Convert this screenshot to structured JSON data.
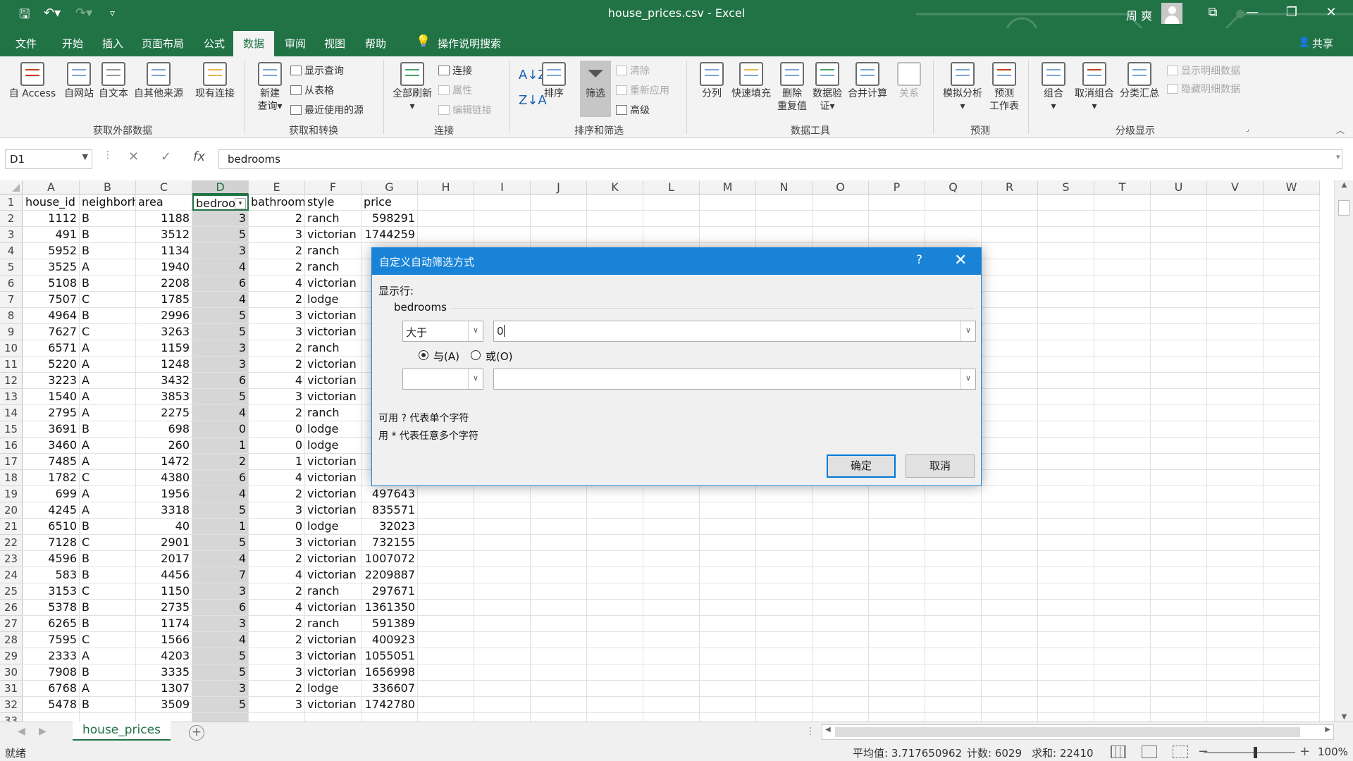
{
  "window": {
    "title": "house_prices.csv  -  Excel",
    "user": "周 爽"
  },
  "menu": {
    "tabs": [
      "文件",
      "开始",
      "插入",
      "页面布局",
      "公式",
      "数据",
      "审阅",
      "视图",
      "帮助"
    ],
    "active": "数据",
    "search": "操作说明搜索",
    "share": "共享"
  },
  "ribbon": {
    "ext": {
      "access": "自 Access",
      "web": "自网站",
      "text": "自文本",
      "other": "自其他来源",
      "existing": "现有连接",
      "label": "获取外部数据"
    },
    "gt": {
      "newq1": "新建",
      "newq2": "查询",
      "show": "显示查询",
      "table": "从表格",
      "recent": "最近使用的源",
      "label": "获取和转换"
    },
    "conn": {
      "refresh": "全部刷新",
      "connections": "连接",
      "properties": "属性",
      "editlinks": "编辑链接",
      "label": "连接"
    },
    "sort": {
      "sort": "排序",
      "filter": "筛选",
      "clear": "清除",
      "reapply": "重新应用",
      "advanced": "高级",
      "label": "排序和筛选"
    },
    "tools": {
      "t2c": "分列",
      "flash": "快速填充",
      "dup1": "删除",
      "dup2": "重复值",
      "val1": "数据验",
      "val2": "证",
      "consolidate": "合并计算",
      "relations": "关系",
      "label": "数据工具"
    },
    "forecast": {
      "whatif": "模拟分析",
      "sheet1": "预测",
      "sheet2": "工作表",
      "label": "预测"
    },
    "outline": {
      "group": "组合",
      "ungroup": "取消组合",
      "subtotal": "分类汇总",
      "showdetail": "显示明细数据",
      "hidedetail": "隐藏明细数据",
      "label": "分级显示"
    }
  },
  "formula": {
    "namebox": "D1",
    "fx": "fx",
    "content": "bedrooms"
  },
  "grid": {
    "columns": [
      "A",
      "B",
      "C",
      "D",
      "E",
      "F",
      "G",
      "H",
      "I",
      "J",
      "K",
      "L",
      "M",
      "N",
      "O",
      "P",
      "Q",
      "R",
      "S",
      "T",
      "U",
      "V",
      "W"
    ],
    "headers": [
      "house_id",
      "neighborh",
      "area",
      "bedroo",
      "bathroom",
      "style",
      "price"
    ],
    "rows": [
      [
        "1112",
        "B",
        "1188",
        "3",
        "2",
        "ranch",
        "598291"
      ],
      [
        "491",
        "B",
        "3512",
        "5",
        "3",
        "victorian",
        "1744259"
      ],
      [
        "5952",
        "B",
        "1134",
        "3",
        "2",
        "ranch",
        ""
      ],
      [
        "3525",
        "A",
        "1940",
        "4",
        "2",
        "ranch",
        ""
      ],
      [
        "5108",
        "B",
        "2208",
        "6",
        "4",
        "victorian",
        ""
      ],
      [
        "7507",
        "C",
        "1785",
        "4",
        "2",
        "lodge",
        ""
      ],
      [
        "4964",
        "B",
        "2996",
        "5",
        "3",
        "victorian",
        ""
      ],
      [
        "7627",
        "C",
        "3263",
        "5",
        "3",
        "victorian",
        ""
      ],
      [
        "6571",
        "A",
        "1159",
        "3",
        "2",
        "ranch",
        ""
      ],
      [
        "5220",
        "A",
        "1248",
        "3",
        "2",
        "victorian",
        ""
      ],
      [
        "3223",
        "A",
        "3432",
        "6",
        "4",
        "victorian",
        ""
      ],
      [
        "1540",
        "A",
        "3853",
        "5",
        "3",
        "victorian",
        ""
      ],
      [
        "2795",
        "A",
        "2275",
        "4",
        "2",
        "ranch",
        ""
      ],
      [
        "3691",
        "B",
        "698",
        "0",
        "0",
        "lodge",
        ""
      ],
      [
        "3460",
        "A",
        "260",
        "1",
        "0",
        "lodge",
        ""
      ],
      [
        "7485",
        "A",
        "1472",
        "2",
        "1",
        "victorian",
        ""
      ],
      [
        "1782",
        "C",
        "4380",
        "6",
        "4",
        "victorian",
        ""
      ],
      [
        "699",
        "A",
        "1956",
        "4",
        "2",
        "victorian",
        "497643"
      ],
      [
        "4245",
        "A",
        "3318",
        "5",
        "3",
        "victorian",
        "835571"
      ],
      [
        "6510",
        "B",
        "40",
        "1",
        "0",
        "lodge",
        "32023"
      ],
      [
        "7128",
        "C",
        "2901",
        "5",
        "3",
        "victorian",
        "732155"
      ],
      [
        "4596",
        "B",
        "2017",
        "4",
        "2",
        "victorian",
        "1007072"
      ],
      [
        "583",
        "B",
        "4456",
        "7",
        "4",
        "victorian",
        "2209887"
      ],
      [
        "3153",
        "C",
        "1150",
        "3",
        "2",
        "ranch",
        "297671"
      ],
      [
        "5378",
        "B",
        "2735",
        "6",
        "4",
        "victorian",
        "1361350"
      ],
      [
        "6265",
        "B",
        "1174",
        "3",
        "2",
        "ranch",
        "591389"
      ],
      [
        "7595",
        "C",
        "1566",
        "4",
        "2",
        "victorian",
        "400923"
      ],
      [
        "2333",
        "A",
        "4203",
        "5",
        "3",
        "victorian",
        "1055051"
      ],
      [
        "7908",
        "B",
        "3335",
        "5",
        "3",
        "victorian",
        "1656998"
      ],
      [
        "6768",
        "A",
        "1307",
        "3",
        "2",
        "lodge",
        "336607"
      ],
      [
        "5478",
        "B",
        "3509",
        "5",
        "3",
        "victorian",
        "1742780"
      ]
    ]
  },
  "sheet": {
    "tab": "house_prices"
  },
  "status": {
    "ready": "就绪",
    "average": "平均值: 3.717650962",
    "count": "计数: 6029",
    "sum": "求和: 22410",
    "zoom": "100%"
  },
  "dialog": {
    "title": "自定义自动筛选方式",
    "help": "?",
    "show_rows": "显示行:",
    "field": "bedrooms",
    "op1": "大于",
    "val1": "0",
    "and": "与(A)",
    "or": "或(O)",
    "op2": "",
    "val2": "",
    "hint1": "可用 ? 代表单个字符",
    "hint2": "用 * 代表任意多个字符",
    "ok": "确定",
    "cancel": "取消"
  }
}
